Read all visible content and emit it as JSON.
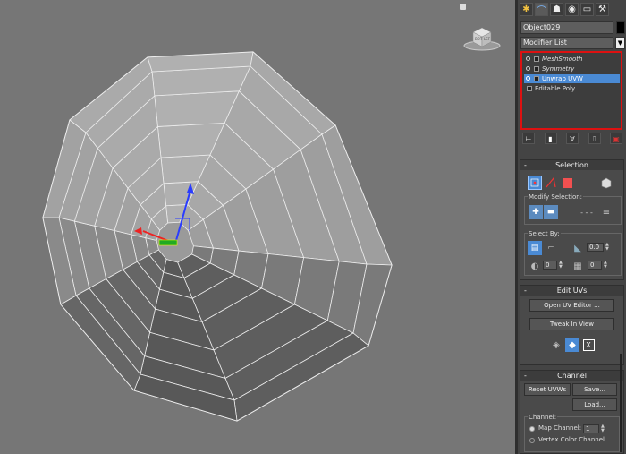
{
  "viewport": {},
  "panel": {
    "tabs": [
      "create-icon",
      "modify-icon",
      "hierarchy-icon",
      "motion-icon",
      "display-icon",
      "utilities-icon"
    ],
    "object_name": "Object029",
    "object_color": "#000000",
    "modifier_list_label": "Modifier List",
    "stack": [
      {
        "label": "MeshSmooth",
        "italic": true,
        "selected": false
      },
      {
        "label": "Symmetry",
        "italic": true,
        "selected": false
      },
      {
        "label": "Unwrap UVW",
        "italic": false,
        "selected": true
      },
      {
        "label": "Editable Poly",
        "italic": false,
        "selected": false,
        "base": true
      }
    ],
    "highlight_color": "#d11111",
    "selection": {
      "title": "Selection",
      "modify_selection_label": "Modify Selection:",
      "select_by_label": "Select By:",
      "angle_value": "0.0",
      "spinner_a": "0",
      "spinner_b": "0"
    },
    "edit_uvs": {
      "title": "Edit UVs",
      "open_editor": "Open UV Editor ...",
      "tweak": "Tweak In View"
    },
    "channel": {
      "title": "Channel",
      "reset": "Reset UVWs",
      "save": "Save...",
      "load": "Load...",
      "channel_label": "Channel:",
      "map_channel_label": "Map Channel:",
      "map_channel_value": "1",
      "vertex_color_label": "Vertex Color Channel"
    }
  }
}
